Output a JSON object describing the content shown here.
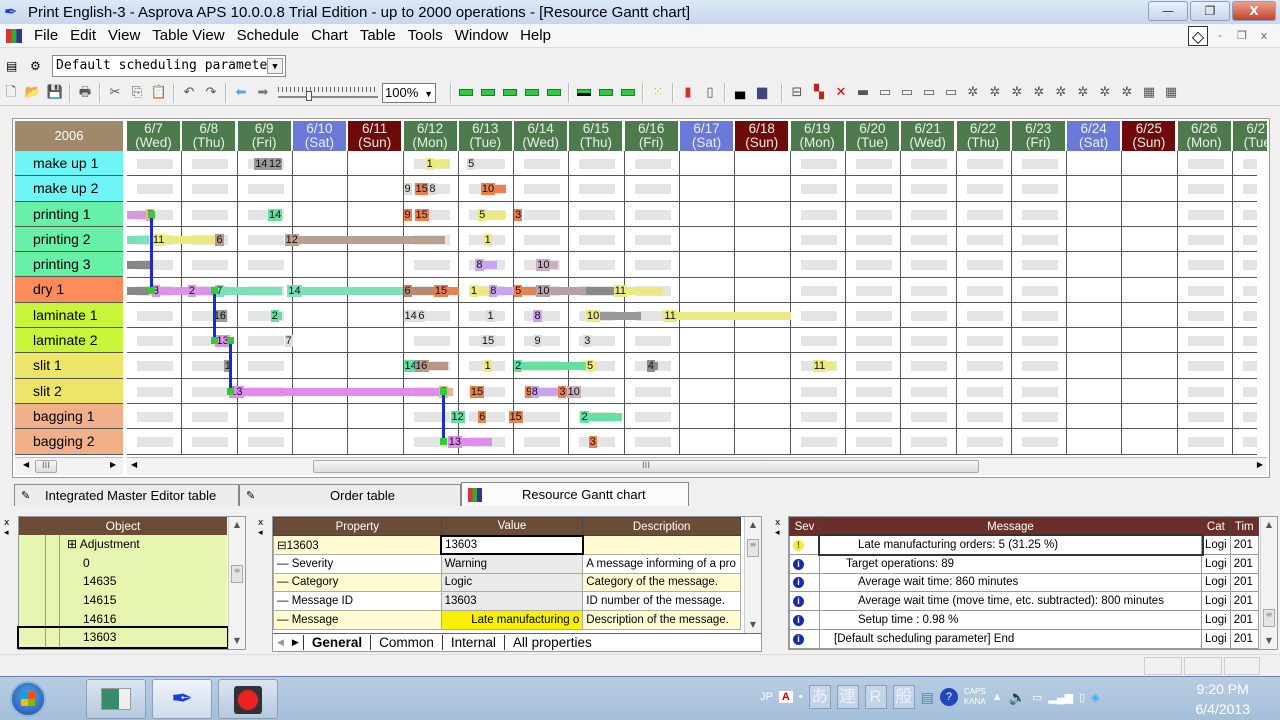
{
  "window": {
    "title": "Print English-3 - Asprova APS 10.0.0.8 Trial Edition  - up to 2000 operations - [Resource Gantt chart]",
    "controls": {
      "minimize": "—",
      "restore": "❐",
      "close": "X"
    }
  },
  "menu": {
    "items": [
      "File",
      "Edit",
      "View",
      "Table View",
      "Schedule",
      "Chart",
      "Table",
      "Tools",
      "Window",
      "Help"
    ],
    "mdi_controls": {
      "diamond": "◇",
      "minimize": "-",
      "restore": "❐",
      "close": "x"
    }
  },
  "toolbar1": {
    "scheduling_parameter": "Default scheduling parameter"
  },
  "toolbar2": {
    "zoom_value": "100%",
    "slider_level": 0.3
  },
  "gantt": {
    "year": "2006",
    "dates": [
      {
        "d": "6/7",
        "w": "(Wed)",
        "type": "weekday"
      },
      {
        "d": "6/8",
        "w": "(Thu)",
        "type": "weekday"
      },
      {
        "d": "6/9",
        "w": "(Fri)",
        "type": "weekday"
      },
      {
        "d": "6/10",
        "w": "(Sat)",
        "type": "sat"
      },
      {
        "d": "6/11",
        "w": "(Sun)",
        "type": "sun"
      },
      {
        "d": "6/12",
        "w": "(Mon)",
        "type": "weekday"
      },
      {
        "d": "6/13",
        "w": "(Tue)",
        "type": "weekday"
      },
      {
        "d": "6/14",
        "w": "(Wed)",
        "type": "weekday"
      },
      {
        "d": "6/15",
        "w": "(Thu)",
        "type": "weekday"
      },
      {
        "d": "6/16",
        "w": "(Fri)",
        "type": "weekday"
      },
      {
        "d": "6/17",
        "w": "(Sat)",
        "type": "sat"
      },
      {
        "d": "6/18",
        "w": "(Sun)",
        "type": "sun"
      },
      {
        "d": "6/19",
        "w": "(Mon)",
        "type": "weekday"
      },
      {
        "d": "6/20",
        "w": "(Tue)",
        "type": "weekday"
      },
      {
        "d": "6/21",
        "w": "(Wed)",
        "type": "weekday"
      },
      {
        "d": "6/22",
        "w": "(Thu)",
        "type": "weekday"
      },
      {
        "d": "6/23",
        "w": "(Fri)",
        "type": "weekday"
      },
      {
        "d": "6/24",
        "w": "(Sat)",
        "type": "sat"
      },
      {
        "d": "6/25",
        "w": "(Sun)",
        "type": "sun"
      },
      {
        "d": "6/26",
        "w": "(Mon)",
        "type": "weekday"
      },
      {
        "d": "6/27",
        "w": "(Tue)",
        "type": "weekday"
      }
    ],
    "day_colors": {
      "weekday": "#4e7a4e",
      "sat": "#6a78d8",
      "sun": "#6e0a0a"
    },
    "resources": [
      {
        "name": "make up 1",
        "color": "#6ff5f5"
      },
      {
        "name": "make up 2",
        "color": "#6ff5f5"
      },
      {
        "name": "printing 1",
        "color": "#66f0a8"
      },
      {
        "name": "printing 2",
        "color": "#66f0a8"
      },
      {
        "name": "printing 3",
        "color": "#66f0a8"
      },
      {
        "name": "dry 1",
        "color": "#ff8a5a"
      },
      {
        "name": "laminate 1",
        "color": "#c8f53a"
      },
      {
        "name": "laminate 2",
        "color": "#c8f53a"
      },
      {
        "name": "slit 1",
        "color": "#ece56a"
      },
      {
        "name": "slit 2",
        "color": "#ece56a"
      },
      {
        "name": "bagging 1",
        "color": "#f0b08a"
      },
      {
        "name": "bagging 2",
        "color": "#f0b08a"
      }
    ],
    "bars": [
      {
        "row": 0,
        "start": 2.3,
        "end": 2.4,
        "color": "#999",
        "label": "14"
      },
      {
        "row": 0,
        "start": 2.55,
        "end": 2.65,
        "color": "#999",
        "label": "12"
      },
      {
        "row": 0,
        "start": 5.4,
        "end": 5.85,
        "color": "#eaea80",
        "label": "1"
      },
      {
        "row": 0,
        "start": 6.15,
        "end": 6.3,
        "color": "#ddd",
        "label": "5"
      },
      {
        "row": 1,
        "start": 5.0,
        "end": 5.1,
        "color": "#ddd",
        "label": "9"
      },
      {
        "row": 1,
        "start": 5.2,
        "end": 5.4,
        "color": "#e98050",
        "label": "15"
      },
      {
        "row": 1,
        "start": 5.45,
        "end": 5.55,
        "color": "#ddd",
        "label": "8"
      },
      {
        "row": 1,
        "start": 6.4,
        "end": 6.85,
        "color": "#e98050",
        "label": "10"
      },
      {
        "row": 2,
        "start": -0.1,
        "end": 0.35,
        "color": "#d995e8",
        "label": ""
      },
      {
        "row": 2,
        "start": 0.35,
        "end": 0.5,
        "color": "#f2b090",
        "label": "7"
      },
      {
        "row": 2,
        "start": 2.55,
        "end": 2.8,
        "color": "#66e0a0",
        "label": "14"
      },
      {
        "row": 2,
        "start": 5.0,
        "end": 5.15,
        "color": "#e98050",
        "label": "9"
      },
      {
        "row": 2,
        "start": 5.2,
        "end": 5.35,
        "color": "#e98050",
        "label": "15"
      },
      {
        "row": 2,
        "start": 6.35,
        "end": 6.85,
        "color": "#eaea80",
        "label": "5"
      },
      {
        "row": 2,
        "start": 7.0,
        "end": 7.15,
        "color": "#e98050",
        "label": "3"
      },
      {
        "row": 3,
        "start": -0.1,
        "end": 0.4,
        "color": "#7ee0b8",
        "label": ""
      },
      {
        "row": 3,
        "start": 0.45,
        "end": 1.6,
        "color": "#eaea80",
        "label": "11"
      },
      {
        "row": 3,
        "start": 1.6,
        "end": 1.75,
        "color": "#b8968a",
        "label": "6"
      },
      {
        "row": 3,
        "start": 2.85,
        "end": 5.75,
        "color": "#b8a090",
        "label": "12"
      },
      {
        "row": 3,
        "start": 6.45,
        "end": 6.6,
        "color": "#eaea80",
        "label": "1"
      },
      {
        "row": 4,
        "start": -0.1,
        "end": 0.45,
        "color": "#888",
        "label": ""
      },
      {
        "row": 4,
        "start": 6.3,
        "end": 6.7,
        "color": "#c9a4f0",
        "label": "8"
      },
      {
        "row": 4,
        "start": 7.4,
        "end": 7.8,
        "color": "#c8b0c0",
        "label": "10"
      },
      {
        "row": 5,
        "start": -0.1,
        "end": 0.4,
        "color": "#888",
        "label": ""
      },
      {
        "row": 5,
        "start": 0.45,
        "end": 1.1,
        "color": "#d995e8",
        "label": "3"
      },
      {
        "row": 5,
        "start": 1.1,
        "end": 1.6,
        "color": "#d995e8",
        "label": "2"
      },
      {
        "row": 5,
        "start": 1.6,
        "end": 2.8,
        "color": "#7ee0b8",
        "label": "7"
      },
      {
        "row": 5,
        "start": 2.9,
        "end": 5.0,
        "color": "#7ee0b8",
        "label": "14"
      },
      {
        "row": 5,
        "start": 5.0,
        "end": 5.55,
        "color": "#b88870",
        "label": "6"
      },
      {
        "row": 5,
        "start": 5.55,
        "end": 6.0,
        "color": "#e98050",
        "label": "15"
      },
      {
        "row": 5,
        "start": 6.2,
        "end": 6.55,
        "color": "#eaea80",
        "label": "1"
      },
      {
        "row": 5,
        "start": 6.55,
        "end": 7.0,
        "color": "#c9a4f0",
        "label": "8"
      },
      {
        "row": 5,
        "start": 7.0,
        "end": 7.4,
        "color": "#e98050",
        "label": "5"
      },
      {
        "row": 5,
        "start": 7.4,
        "end": 8.3,
        "color": "#b8a0a8",
        "label": "10"
      },
      {
        "row": 5,
        "start": 8.3,
        "end": 8.8,
        "color": "#8a8a8a",
        "label": ""
      },
      {
        "row": 5,
        "start": 8.8,
        "end": 9.7,
        "color": "#eaea80",
        "label": "11"
      },
      {
        "row": 6,
        "start": 1.55,
        "end": 1.7,
        "color": "#999",
        "label": "16"
      },
      {
        "row": 6,
        "start": 2.6,
        "end": 2.8,
        "color": "#66e0a0",
        "label": "2"
      },
      {
        "row": 6,
        "start": 5.0,
        "end": 5.2,
        "color": "#ddd",
        "label": "14"
      },
      {
        "row": 6,
        "start": 5.25,
        "end": 5.35,
        "color": "#ddd",
        "label": "6"
      },
      {
        "row": 6,
        "start": 6.5,
        "end": 6.6,
        "color": "#ddd",
        "label": "1"
      },
      {
        "row": 6,
        "start": 7.35,
        "end": 7.45,
        "color": "#c9a4f0",
        "label": "8"
      },
      {
        "row": 6,
        "start": 8.3,
        "end": 8.5,
        "color": "#eaea80",
        "label": "10"
      },
      {
        "row": 6,
        "start": 8.55,
        "end": 9.3,
        "color": "#999",
        "label": ""
      },
      {
        "row": 6,
        "start": 9.7,
        "end": 12.0,
        "color": "#eaea80",
        "label": "11"
      },
      {
        "row": 7,
        "start": 1.6,
        "end": 1.85,
        "color": "#d995e8",
        "label": "13"
      },
      {
        "row": 7,
        "start": 2.85,
        "end": 2.9,
        "color": "#ddd",
        "label": "7"
      },
      {
        "row": 7,
        "start": 6.4,
        "end": 6.5,
        "color": "#ddd",
        "label": "15"
      },
      {
        "row": 7,
        "start": 7.35,
        "end": 7.45,
        "color": "#ddd",
        "label": "9"
      },
      {
        "row": 7,
        "start": 8.25,
        "end": 8.35,
        "color": "#ddd",
        "label": "3"
      },
      {
        "row": 8,
        "start": 1.75,
        "end": 1.9,
        "color": "#999",
        "label": "1"
      },
      {
        "row": 8,
        "start": 5.0,
        "end": 5.2,
        "color": "#66e0a0",
        "label": "14"
      },
      {
        "row": 8,
        "start": 5.2,
        "end": 5.3,
        "color": "#999",
        "label": "12"
      },
      {
        "row": 8,
        "start": 5.3,
        "end": 5.8,
        "color": "#b89880",
        "label": "6"
      },
      {
        "row": 8,
        "start": 6.45,
        "end": 6.55,
        "color": "#eaea80",
        "label": "1"
      },
      {
        "row": 8,
        "start": 7.0,
        "end": 8.3,
        "color": "#66e0a0",
        "label": "2"
      },
      {
        "row": 8,
        "start": 8.3,
        "end": 8.5,
        "color": "#eaea80",
        "label": "5"
      },
      {
        "row": 8,
        "start": 9.4,
        "end": 9.6,
        "color": "#8a8a8a",
        "label": "4"
      },
      {
        "row": 8,
        "start": 12.4,
        "end": 12.8,
        "color": "#eaea80",
        "label": "11"
      },
      {
        "row": 9,
        "start": 1.85,
        "end": 5.65,
        "color": "#e38aef",
        "label": "13"
      },
      {
        "row": 9,
        "start": 5.65,
        "end": 5.9,
        "color": "#f2b090",
        "label": "7"
      },
      {
        "row": 9,
        "start": 6.2,
        "end": 6.4,
        "color": "#e98050",
        "label": "15"
      },
      {
        "row": 9,
        "start": 7.2,
        "end": 7.3,
        "color": "#e98050",
        "label": "9"
      },
      {
        "row": 9,
        "start": 7.3,
        "end": 7.8,
        "color": "#c9a4f0",
        "label": "8"
      },
      {
        "row": 9,
        "start": 7.8,
        "end": 7.95,
        "color": "#e98050",
        "label": "3"
      },
      {
        "row": 9,
        "start": 7.95,
        "end": 8.2,
        "color": "#c8b0c0",
        "label": "10"
      },
      {
        "row": 10,
        "start": 5.85,
        "end": 5.95,
        "color": "#66e0a0",
        "label": "12"
      },
      {
        "row": 10,
        "start": 6.35,
        "end": 6.45,
        "color": "#e98050",
        "label": "6"
      },
      {
        "row": 10,
        "start": 6.9,
        "end": 7.0,
        "color": "#e98050",
        "label": "15"
      },
      {
        "row": 10,
        "start": 8.2,
        "end": 8.95,
        "color": "#66e0a0",
        "label": "2"
      },
      {
        "row": 11,
        "start": 5.8,
        "end": 6.6,
        "color": "#e38aef",
        "label": "13"
      },
      {
        "row": 11,
        "start": 8.35,
        "end": 8.5,
        "color": "#e98050",
        "label": "3"
      }
    ],
    "links": [
      {
        "x": 0.42,
        "r1": 2,
        "r2": 5
      },
      {
        "x": 1.55,
        "r1": 5,
        "r2": 7
      },
      {
        "x": 1.85,
        "r1": 7,
        "r2": 9
      },
      {
        "x": 5.7,
        "r1": 9,
        "r2": 11
      }
    ],
    "hscroll_thumb": "III",
    "left_scroll_thumb": "III"
  },
  "tabs": [
    {
      "label": "Integrated Master Editor table",
      "active": false
    },
    {
      "label": "Order table",
      "active": false
    },
    {
      "label": "Resource Gantt chart",
      "active": true
    }
  ],
  "object_panel": {
    "header": "Object",
    "items": [
      {
        "label": "Adjustment",
        "expandable": true
      },
      {
        "label": "0"
      },
      {
        "label": "14635"
      },
      {
        "label": "14615"
      },
      {
        "label": "14616"
      },
      {
        "label": "13603",
        "selected": true
      }
    ]
  },
  "property_panel": {
    "headers": [
      "Property",
      "Value",
      "Description"
    ],
    "rows": [
      {
        "property": "13603",
        "value": "13603",
        "description": "",
        "root": true
      },
      {
        "property": "Severity",
        "value": "Warning",
        "description": "A message informing of a pro"
      },
      {
        "property": "Category",
        "value": "Logic",
        "description": "Category of the message."
      },
      {
        "property": "Message ID",
        "value": "13603",
        "description": "ID number of the message."
      },
      {
        "property": "Message",
        "value": "Late manufacturing o",
        "description": "Description of the message."
      }
    ],
    "tabs": [
      "General",
      "Common",
      "Internal",
      "All properties"
    ]
  },
  "message_panel": {
    "headers": [
      "Sev",
      "Message",
      "Cat",
      "Tim"
    ],
    "rows": [
      {
        "sev": "warning",
        "message": "Late manufacturing orders: 5 (31.25 %)",
        "cat": "Logi",
        "time": "201",
        "indent": 3
      },
      {
        "sev": "info",
        "message": "Target operations: 89",
        "cat": "Logi",
        "time": "201",
        "indent": 2
      },
      {
        "sev": "info",
        "message": "Average wait time: 860 minutes",
        "cat": "Logi",
        "time": "201",
        "indent": 3
      },
      {
        "sev": "info",
        "message": "Average wait time (move time, etc. subtracted): 800 minutes",
        "cat": "Logi",
        "time": "201",
        "indent": 3
      },
      {
        "sev": "info",
        "message": "Setup time : 0.98 %",
        "cat": "Logi",
        "time": "201",
        "indent": 3
      },
      {
        "sev": "info",
        "message": "[Default scheduling parameter] End",
        "cat": "Logi",
        "time": "201",
        "indent": 1
      }
    ]
  },
  "taskbar": {
    "tray": {
      "lang": "JP",
      "ime": [
        "あ",
        "連",
        "R",
        "般"
      ],
      "caps": "CAPS",
      "kana": "KANA"
    },
    "clock": {
      "time": "9:20 PM",
      "date": "6/4/2013"
    }
  }
}
